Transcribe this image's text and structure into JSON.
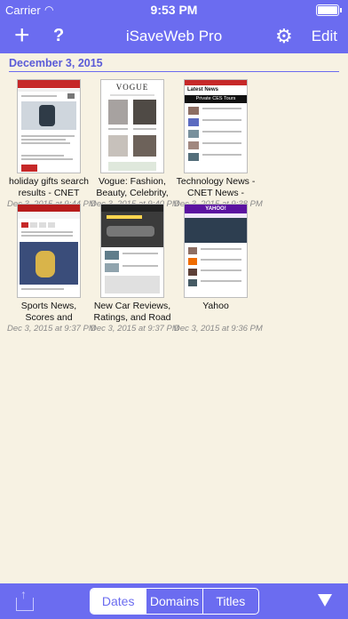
{
  "status": {
    "carrier": "Carrier",
    "time": "9:53 PM"
  },
  "nav": {
    "add": "+",
    "help": "?",
    "title": "iSaveWeb Pro",
    "edit": "Edit"
  },
  "section": {
    "title": "December 3, 2015"
  },
  "items": [
    {
      "title": "holiday gifts search results - CNET",
      "date": "Dec 3, 2015 at 9:44 PM"
    },
    {
      "title": "Vogue: Fashion, Beauty, Celebrity, Fa...",
      "date": "Dec 3, 2015 at 9:40 PM"
    },
    {
      "title": "Technology News - CNET News - CNET",
      "date": "Dec 3, 2015 at 9:38 PM"
    },
    {
      "title": "Sports News, Scores and Highlights fr...",
      "date": "Dec 3, 2015 at 9:37 PM"
    },
    {
      "title": "New Car Reviews, Ratings, and Road Te...",
      "date": "Dec 3, 2015 at 9:37 PM"
    },
    {
      "title": "Yahoo",
      "date": "Dec 3, 2015 at 9:36 PM"
    }
  ],
  "thumb_text": {
    "vogue": "VOGUE",
    "latest_news": "Latest News",
    "private_ces": "Private CES Tours",
    "yahoo": "YAHOO!"
  },
  "tabs": [
    "Dates",
    "Domains",
    "Titles"
  ],
  "colors": {
    "accent": "#6b6cf0",
    "background": "#f7f2e3"
  }
}
